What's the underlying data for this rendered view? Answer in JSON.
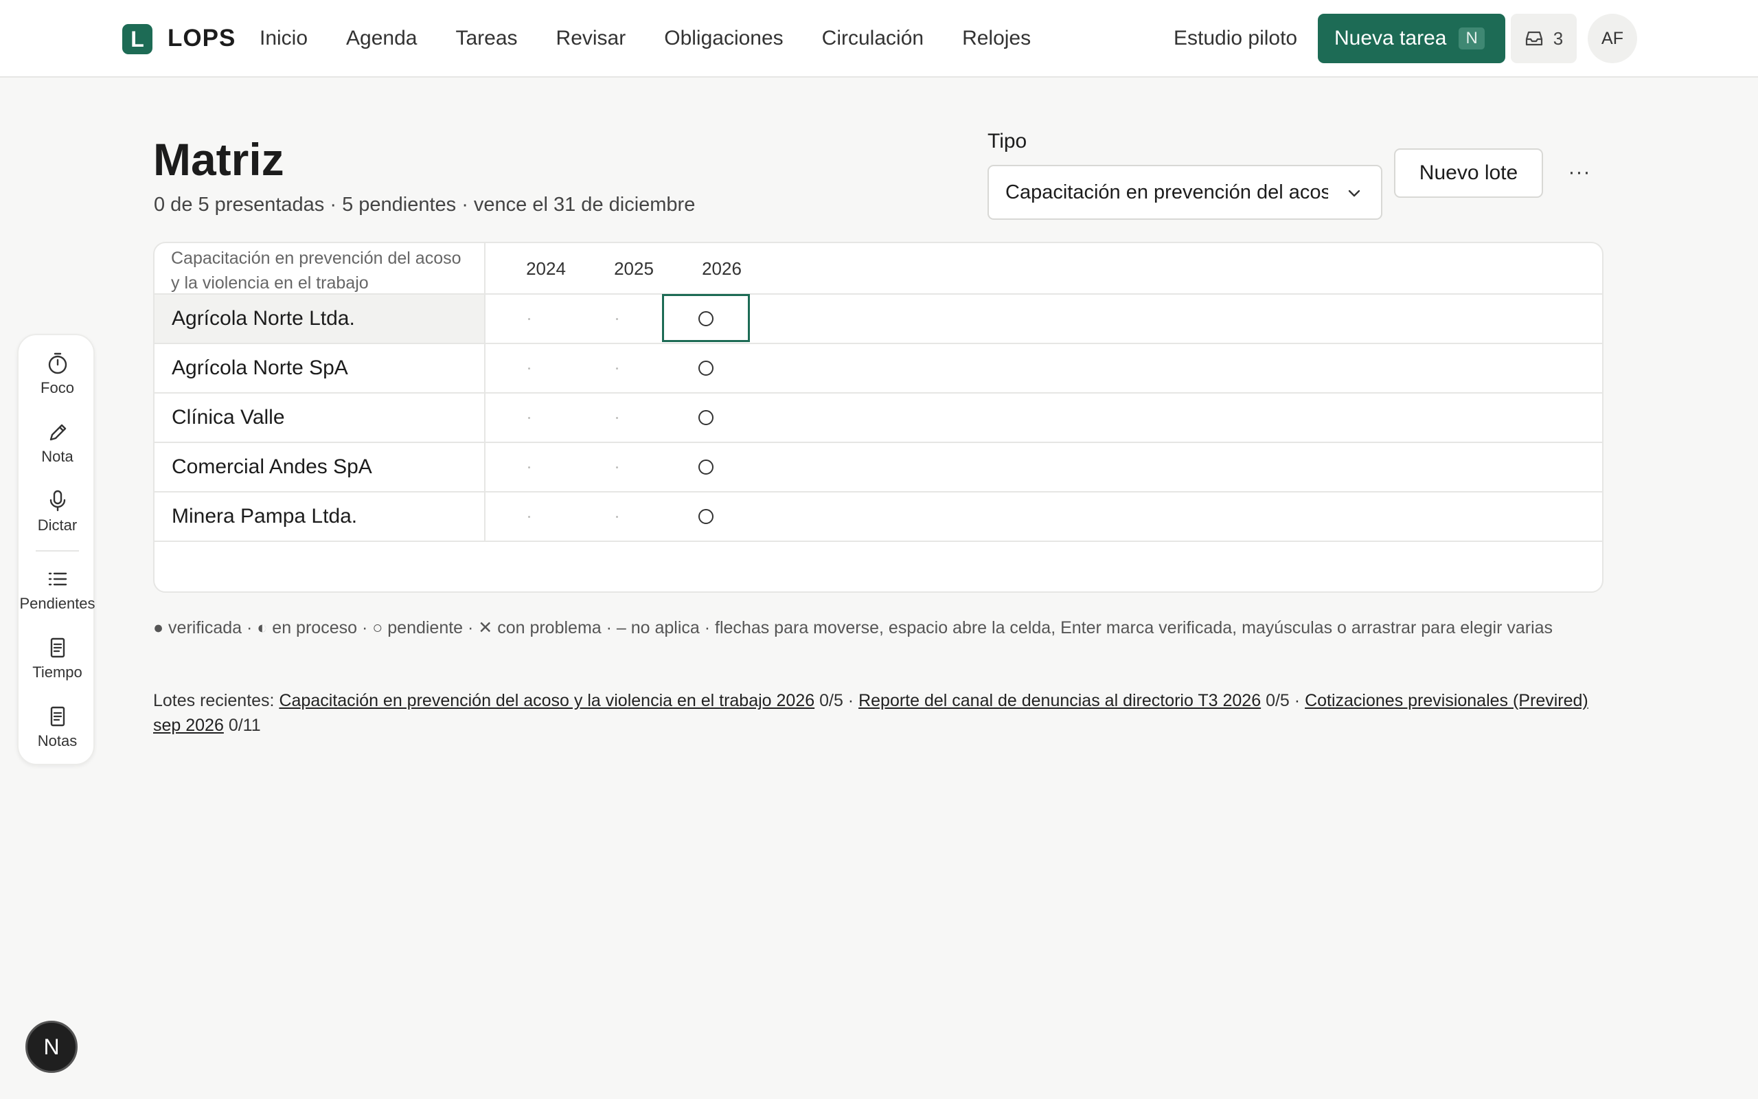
{
  "brand": {
    "logo_letter": "L",
    "name": "LOPS"
  },
  "nav": [
    "Inicio",
    "Agenda",
    "Tareas",
    "Revisar",
    "Obligaciones",
    "Circulación",
    "Relojes"
  ],
  "org": "Estudio piloto",
  "new_task": {
    "label": "Nueva tarea",
    "shortcut": "N"
  },
  "inbox_count": "3",
  "avatar": "AF",
  "page": {
    "title": "Matriz",
    "subtitle": "0 de 5 presentadas · 5 pendientes · vence el 31 de diciembre"
  },
  "filter": {
    "label": "Tipo",
    "selected": "Capacitación en prevención del acoso y la violencia en el trabajo"
  },
  "new_batch": "Nuevo lote",
  "more": "···",
  "matrix": {
    "header": "Capacitación en prevención del acoso y la violencia en el trabajo",
    "years": [
      "2024",
      "2025",
      "2026"
    ],
    "rows": [
      {
        "name": "Agrícola Norte Ltda.",
        "cells": [
          "no aplica",
          "no aplica",
          "pendiente"
        ]
      },
      {
        "name": "Agrícola Norte SpA",
        "cells": [
          "no aplica",
          "no aplica",
          "pendiente"
        ]
      },
      {
        "name": "Clínica Valle",
        "cells": [
          "no aplica",
          "no aplica",
          "pendiente"
        ]
      },
      {
        "name": "Comercial Andes SpA",
        "cells": [
          "no aplica",
          "no aplica",
          "pendiente"
        ]
      },
      {
        "name": "Minera Pampa Ltda.",
        "cells": [
          "no aplica",
          "no aplica",
          "pendiente"
        ]
      }
    ]
  },
  "legend": "● verificada · ◐ en proceso · ○ pendiente · ✕ con problema · – no aplica · flechas para moverse, espacio abre la celda, Enter marca verificada, mayúsculas o arrastrar para elegir varias",
  "recent": {
    "label": "Lotes recientes:",
    "items": [
      {
        "name": "Capacitación en prevención del acoso y la violencia en el trabajo 2026",
        "count": "0/5"
      },
      {
        "name": "Reporte del canal de denuncias al directorio T3 2026",
        "count": "0/5"
      },
      {
        "name": "Cotizaciones previsionales (Previred) sep 2026",
        "count": "0/11"
      }
    ]
  },
  "dock": [
    "Foco",
    "Nota",
    "Dictar",
    "Pendientes",
    "Tiempo",
    "Notas"
  ],
  "bottom_badge": "N",
  "colors": {
    "accent": "#1d6b55",
    "background": "#f7f7f6"
  }
}
